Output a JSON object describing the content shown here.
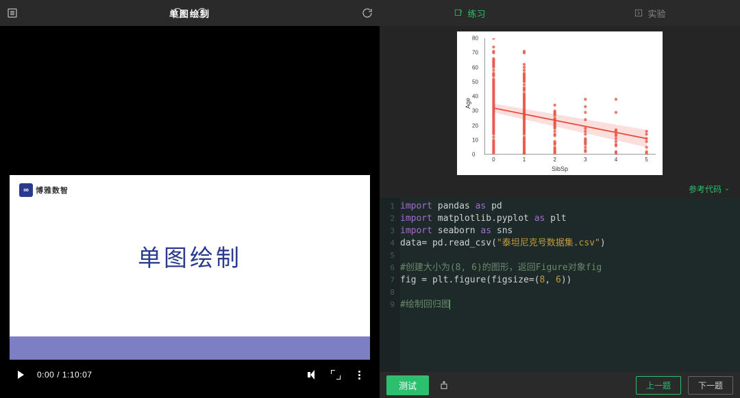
{
  "left_header": {
    "title": "单图绘制"
  },
  "slide": {
    "logo_text": "博雅数智",
    "logo_mark": "∞",
    "title": "单图绘制"
  },
  "video": {
    "current_time": "0:00",
    "total_time": "1:10:07"
  },
  "tabs": {
    "practice": "练习",
    "experiment": "实验"
  },
  "ref_link": "参考代码",
  "chart_data": {
    "type": "scatter",
    "title": "",
    "xlabel": "SibSp",
    "ylabel": "Age",
    "xlim": [
      -0.3,
      5.3
    ],
    "ylim": [
      0,
      80
    ],
    "xticks": [
      0,
      1,
      2,
      3,
      4,
      5
    ],
    "yticks": [
      0,
      10,
      20,
      30,
      40,
      50,
      60,
      70,
      80
    ],
    "regression": {
      "x0": 0,
      "y0": 32,
      "x1": 5,
      "y1": 11
    },
    "series": [
      {
        "x": 0,
        "ys": [
          1,
          2,
          3,
          4,
          5,
          6,
          7,
          8,
          9,
          10,
          12,
          14,
          15,
          16,
          17,
          18,
          19,
          20,
          21,
          22,
          23,
          24,
          25,
          26,
          27,
          28,
          29,
          30,
          31,
          32,
          33,
          34,
          35,
          36,
          37,
          38,
          39,
          40,
          41,
          42,
          43,
          44,
          45,
          46,
          47,
          48,
          49,
          50,
          51,
          52,
          54,
          55,
          56,
          58,
          60,
          61,
          62,
          63,
          64,
          65,
          66,
          70,
          71,
          74,
          80
        ]
      },
      {
        "x": 1,
        "ys": [
          0.5,
          1,
          2,
          3,
          4,
          5,
          6,
          7,
          8,
          9,
          10,
          11,
          12,
          14,
          15,
          16,
          17,
          18,
          19,
          20,
          21,
          22,
          23,
          24,
          25,
          26,
          27,
          28,
          29,
          30,
          31,
          32,
          33,
          34,
          35,
          36,
          37,
          38,
          39,
          40,
          41,
          42,
          44,
          45,
          46,
          48,
          50,
          51,
          52,
          53,
          54,
          55,
          56,
          58,
          60,
          62,
          70,
          71
        ]
      },
      {
        "x": 2,
        "ys": [
          1,
          2,
          3,
          4,
          5,
          7,
          8,
          9,
          13,
          14,
          16,
          18,
          19,
          20,
          21,
          22,
          23,
          24,
          25,
          27,
          28,
          29,
          30,
          34
        ]
      },
      {
        "x": 3,
        "ys": [
          2,
          3,
          5,
          7,
          8,
          9,
          10,
          11,
          14,
          16,
          18,
          24,
          29,
          33,
          38
        ]
      },
      {
        "x": 4,
        "ys": [
          1,
          2,
          6,
          7,
          9,
          11,
          13,
          14,
          16,
          17,
          29,
          38
        ]
      },
      {
        "x": 5,
        "ys": [
          1,
          2,
          5,
          9,
          11,
          14,
          16
        ]
      }
    ]
  },
  "code": {
    "lines": [
      {
        "n": 1,
        "tokens": [
          [
            "kw",
            "import"
          ],
          [
            "sp",
            " "
          ],
          [
            "mod",
            "pandas"
          ],
          [
            "sp",
            " "
          ],
          [
            "kw",
            "as"
          ],
          [
            "sp",
            " "
          ],
          [
            "mod",
            "pd"
          ]
        ]
      },
      {
        "n": 2,
        "tokens": [
          [
            "kw",
            "import"
          ],
          [
            "sp",
            " "
          ],
          [
            "mod",
            "matplotlib.pyplot"
          ],
          [
            "sp",
            " "
          ],
          [
            "kw",
            "as"
          ],
          [
            "sp",
            " "
          ],
          [
            "mod",
            "plt"
          ]
        ]
      },
      {
        "n": 3,
        "tokens": [
          [
            "kw",
            "import"
          ],
          [
            "sp",
            " "
          ],
          [
            "mod",
            "seaborn"
          ],
          [
            "sp",
            " "
          ],
          [
            "kw",
            "as"
          ],
          [
            "sp",
            " "
          ],
          [
            "mod",
            "sns"
          ]
        ]
      },
      {
        "n": 4,
        "tokens": [
          [
            "mod",
            "data"
          ],
          [
            "sp",
            "= "
          ],
          [
            "mod",
            "pd"
          ],
          [
            "sp",
            "."
          ],
          [
            "fn",
            "read_csv"
          ],
          [
            "sp",
            "("
          ],
          [
            "str",
            "\"泰坦尼克号数据集.csv\""
          ],
          [
            "sp",
            ")"
          ]
        ]
      },
      {
        "n": 5,
        "tokens": []
      },
      {
        "n": 6,
        "tokens": [
          [
            "com",
            "#创建大小为(8, 6)的图形，返回Figure对象fig"
          ]
        ]
      },
      {
        "n": 7,
        "tokens": [
          [
            "mod",
            "fig"
          ],
          [
            "sp",
            " = "
          ],
          [
            "mod",
            "plt"
          ],
          [
            "sp",
            "."
          ],
          [
            "fn",
            "figure"
          ],
          [
            "sp",
            "(figsize=("
          ],
          [
            "num",
            "8"
          ],
          [
            "sp",
            ", "
          ],
          [
            "num",
            "6"
          ],
          [
            "sp",
            "))"
          ]
        ]
      },
      {
        "n": 8,
        "tokens": []
      },
      {
        "n": 9,
        "tokens": [
          [
            "com",
            "#绘制回归图"
          ]
        ],
        "cursor": true
      }
    ]
  },
  "footer": {
    "test": "测试",
    "prev": "上一题",
    "next": "下一题"
  }
}
